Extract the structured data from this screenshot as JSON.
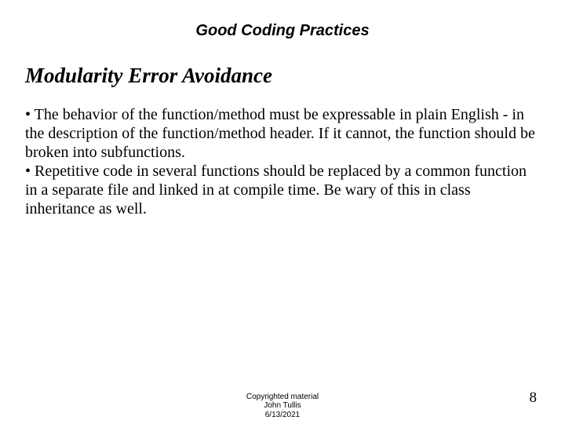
{
  "header": "Good Coding Practices",
  "title": "Modularity Error Avoidance",
  "bullets": [
    "The behavior of the function/method must be expressable in plain English - in the description of the function/method header. If it cannot, the function should be broken into subfunctions.",
    "Repetitive code in several functions should be replaced by a common function in a separate file and linked in at compile time. Be wary of this in class inheritance as well."
  ],
  "footer": {
    "line1": "Copyrighted material",
    "line2": "John Tullis",
    "line3": "6/13/2021"
  },
  "page_number": "8"
}
